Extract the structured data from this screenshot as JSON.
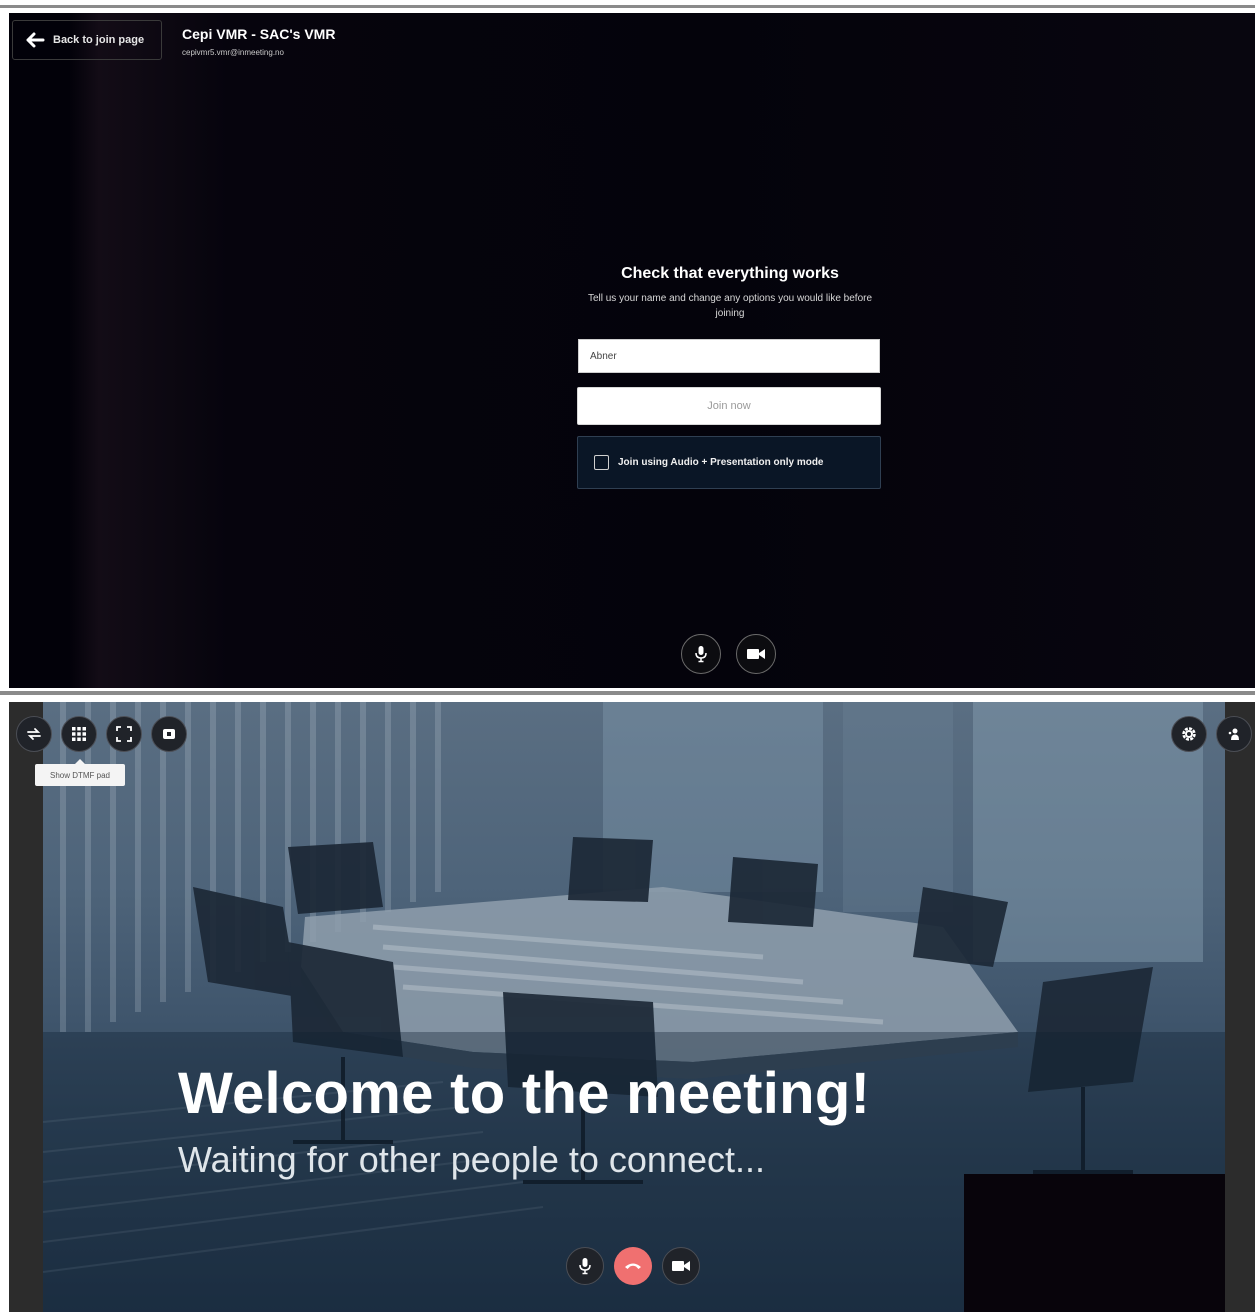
{
  "pre_join": {
    "back_button_label": "Back to join page",
    "room_name": "Cepi VMR - SAC's VMR",
    "room_uri": "cepivmr5.vmr@inmeeting.no",
    "heading": "Check that everything works",
    "subheading": "Tell us your name and change any options you would like before joining",
    "name_value": "Abner",
    "join_button_label": "Join now",
    "audio_only_label": "Join using Audio + Presentation only mode",
    "controls": [
      "microphone-icon",
      "camera-icon"
    ]
  },
  "in_meeting": {
    "toolbar_icons": [
      "switch-layout-icon",
      "dtmf-keypad-icon",
      "fullscreen-icon",
      "presentation-icon"
    ],
    "tooltip": "Show DTMF pad",
    "right_icons": [
      "settings-icon",
      "participants-icon"
    ],
    "welcome_title": "Welcome to the meeting!",
    "waiting_text": "Waiting for other people to connect...",
    "call_controls": [
      "microphone-icon",
      "hang-up-icon",
      "camera-icon"
    ]
  },
  "colors": {
    "hangup": "#f07070",
    "dark_panel": "#04030b",
    "checkbox_panel": "#0a1626"
  }
}
